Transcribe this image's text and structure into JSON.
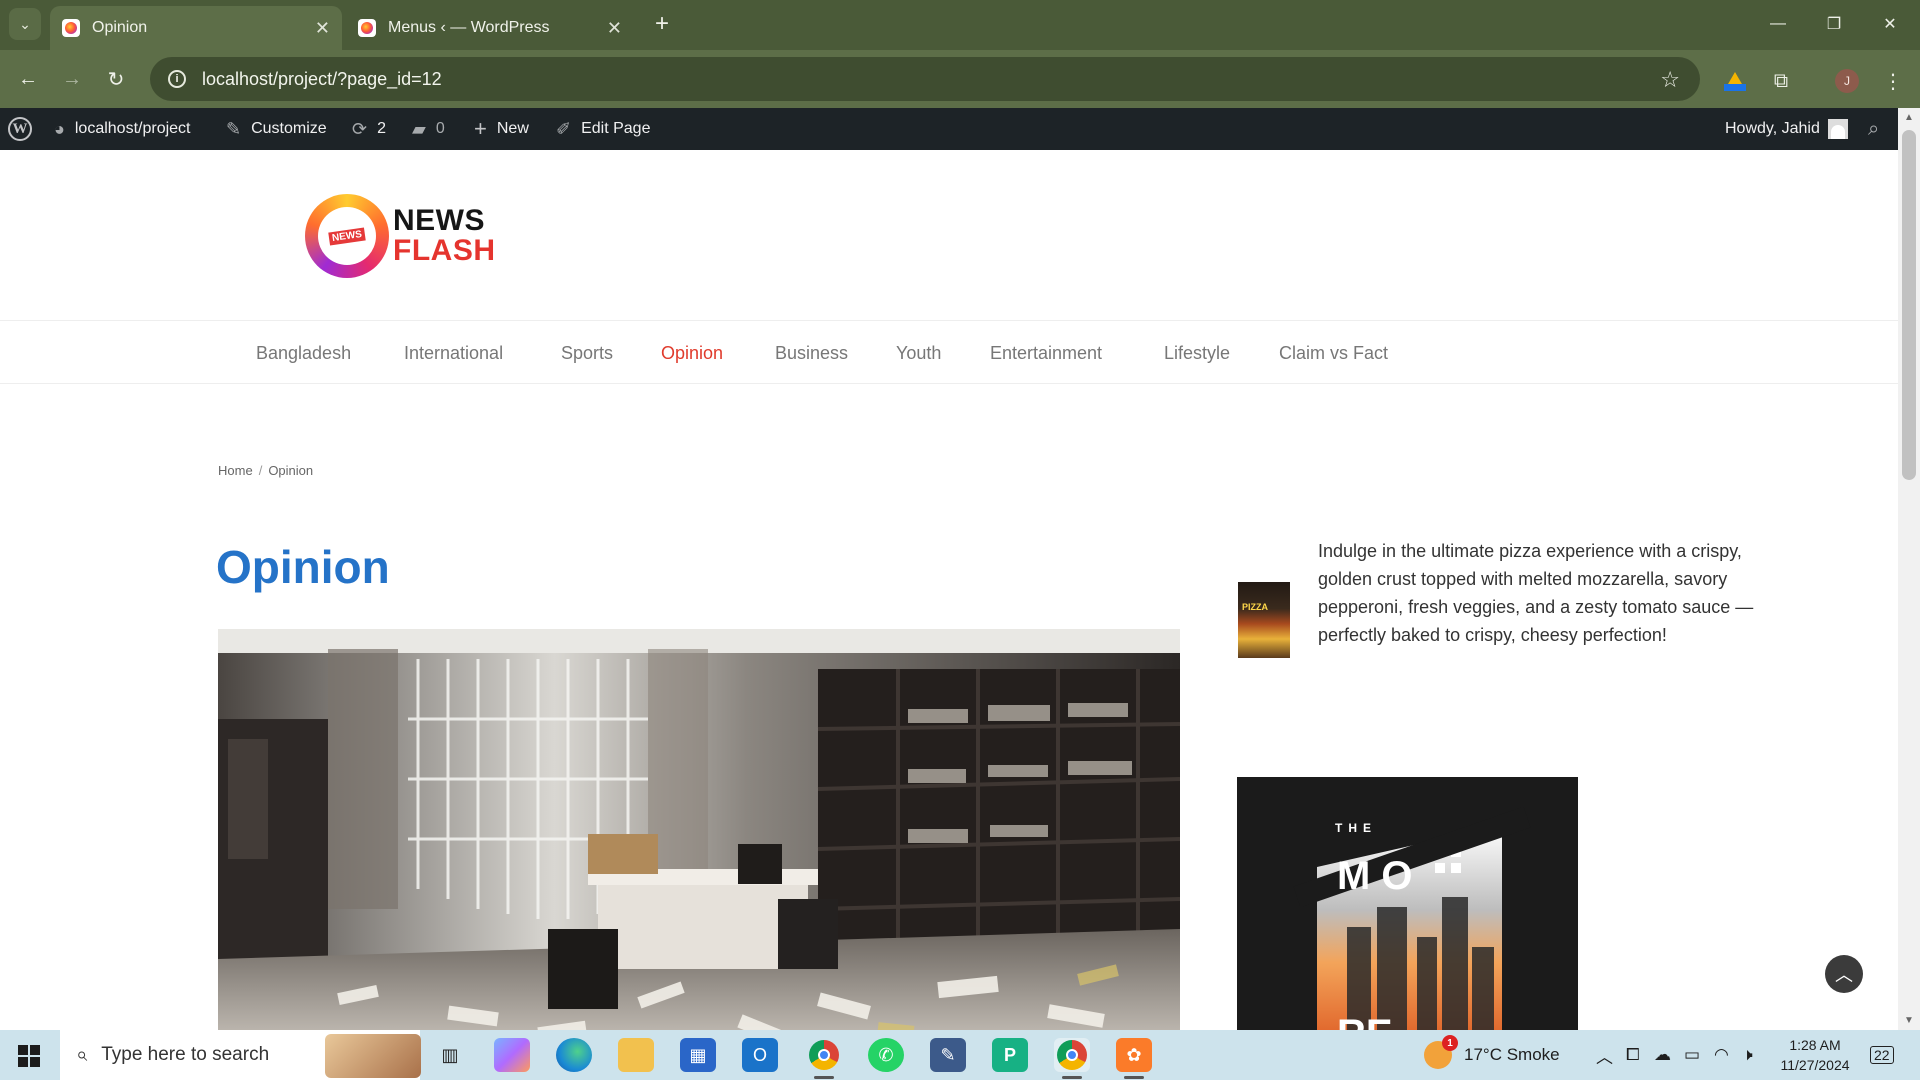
{
  "browser": {
    "tabs": [
      {
        "title": "Opinion",
        "active": true
      },
      {
        "title": "Menus ‹ — WordPress",
        "active": false
      }
    ],
    "new_tab_glyph": "+",
    "url": "localhost/project/?page_id=12",
    "profile_initial": "J",
    "icons": [
      "tab-search-icon",
      "close-icon",
      "back-arrow-icon",
      "forward-arrow-icon",
      "reload-icon",
      "site-info-icon",
      "bookmark-star-icon",
      "google-drive-icon",
      "extensions-icon",
      "kebab-menu-icon",
      "minimize-icon",
      "restore-icon"
    ]
  },
  "wp_admin_bar": {
    "site": "localhost/project",
    "customize": "Customize",
    "updates_count": "2",
    "comments_count": "0",
    "new": "New",
    "edit_page": "Edit Page",
    "greeting": "Howdy, Jahid"
  },
  "site": {
    "logo_word1": "NEWS",
    "logo_word2": "FLASH",
    "logo_badge": "NEWS",
    "brand_red": "#e5342e",
    "title_blue": "#2573c8"
  },
  "nav": {
    "items": [
      {
        "label": "Bangladesh",
        "active": false
      },
      {
        "label": "International",
        "active": false
      },
      {
        "label": "Sports",
        "active": false
      },
      {
        "label": "Opinion",
        "active": true
      },
      {
        "label": "Business",
        "active": false
      },
      {
        "label": "Youth",
        "active": false
      },
      {
        "label": "Entertainment",
        "active": false
      },
      {
        "label": "Lifestyle",
        "active": false
      },
      {
        "label": "Claim vs Fact",
        "active": false
      }
    ]
  },
  "breadcrumb": {
    "home": "Home",
    "separator": "/",
    "current": "Opinion"
  },
  "page_title": "Opinion",
  "sidebar": {
    "thumb_label": "PIZZA",
    "promo_text": "Indulge in the ultimate pizza experience with a crispy, golden crust topped with melted mozzarella, savory pepperoni, fresh veggies, and a zesty tomato sauce —perfectly baked to crispy, cheesy perfection!",
    "ad_text_top": "THE",
    "ad_letters": "M O",
    "ad_partial": "RE"
  },
  "taskbar": {
    "search_placeholder": "Type here to search",
    "weather": "17°C  Smoke",
    "weather_badge": "1",
    "time": "1:28 AM",
    "date": "11/27/2024",
    "notifications": "22"
  }
}
